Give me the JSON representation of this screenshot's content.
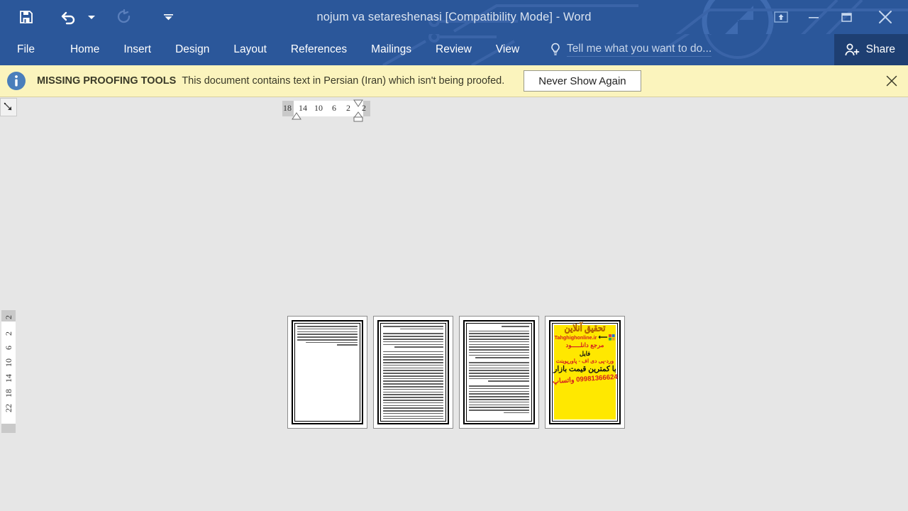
{
  "titlebar": {
    "document_title": "nojum va setareshenasi [Compatibility Mode] - Word",
    "qat": [
      {
        "name": "save-button",
        "label": "Save",
        "icon": "save-icon",
        "enabled": true
      },
      {
        "name": "undo-button",
        "label": "Undo",
        "icon": "undo-icon",
        "enabled": true
      },
      {
        "name": "undo-dropdown",
        "label": "Undo options",
        "icon": "chevron-down-icon",
        "enabled": true
      },
      {
        "name": "redo-button",
        "label": "Repeat",
        "icon": "redo-icon",
        "enabled": false
      },
      {
        "name": "customize-qat-button",
        "label": "Customize Quick Access Toolbar",
        "icon": "chevron-down-icon",
        "enabled": true
      }
    ],
    "window_controls": [
      {
        "name": "ribbon-display-options-button",
        "label": "Ribbon Display Options",
        "icon": "ribbon-options-icon"
      },
      {
        "name": "minimize-button",
        "label": "Minimize",
        "icon": "minimize-icon"
      },
      {
        "name": "restore-button",
        "label": "Restore Down",
        "icon": "restore-icon"
      },
      {
        "name": "close-button",
        "label": "Close",
        "icon": "close-icon"
      }
    ]
  },
  "ribbon": {
    "tabs": [
      {
        "label": "File",
        "active": false
      },
      {
        "label": "Home",
        "active": false
      },
      {
        "label": "Insert",
        "active": false
      },
      {
        "label": "Design",
        "active": false
      },
      {
        "label": "Layout",
        "active": false
      },
      {
        "label": "References",
        "active": false
      },
      {
        "label": "Mailings",
        "active": false
      },
      {
        "label": "Review",
        "active": false
      },
      {
        "label": "View",
        "active": false
      }
    ],
    "tell_me": {
      "placeholder": "Tell me what you want to do...",
      "icon": "lightbulb-icon"
    },
    "share": {
      "label": "Share",
      "icon": "share-person-icon"
    }
  },
  "notification": {
    "icon": "info-icon",
    "title": "MISSING PROOFING TOOLS",
    "message": "This document contains text in Persian (Iran) which isn't being proofed.",
    "action_label": "Never Show Again",
    "close_icon": "close-icon",
    "background_color": "#fbf4bd"
  },
  "rulers": {
    "tab_selector_icon": "left-tab-stop-icon",
    "horizontal_numbers": [
      "18",
      "14",
      "10",
      "6",
      "2",
      "2"
    ],
    "vertical_numbers": [
      "22",
      "18",
      "14",
      "10",
      "6",
      "2",
      "2"
    ],
    "indent_markers": [
      "first-line-indent-marker",
      "hanging-indent-marker",
      "left-indent-marker"
    ]
  },
  "document": {
    "view_mode": "multiple-pages",
    "page_count": 4,
    "pages": [
      {
        "name": "page-1",
        "type": "text",
        "lines": 8,
        "align": "rtl",
        "fill_ratio": 0.22
      },
      {
        "name": "page-2",
        "type": "text",
        "lines": 40,
        "align": "rtl",
        "fill_ratio": 1.0
      },
      {
        "name": "page-3",
        "type": "text",
        "lines": 40,
        "align": "rtl",
        "fill_ratio": 1.0
      },
      {
        "name": "page-4",
        "type": "advertisement",
        "align": "rtl"
      }
    ],
    "ad_page": {
      "background_color": "#ffe800",
      "line1": "تحقیق آنلاین",
      "line2": "Tahghighonline.ir",
      "line3": "مرجع دانلـــــود",
      "line4": "فایل",
      "line5": "ورد-پی دی اف - پاورپوینت",
      "line6": "با کمترین قیمت بازار",
      "line7": "09981366624 واتساپ"
    }
  },
  "colors": {
    "title_bar": "#2b579a",
    "share_button": "#1e3f72",
    "canvas": "#e6e6e6",
    "notify_bg": "#fbf4bd",
    "ad_yellow": "#ffe800",
    "ad_red": "#d42020"
  }
}
